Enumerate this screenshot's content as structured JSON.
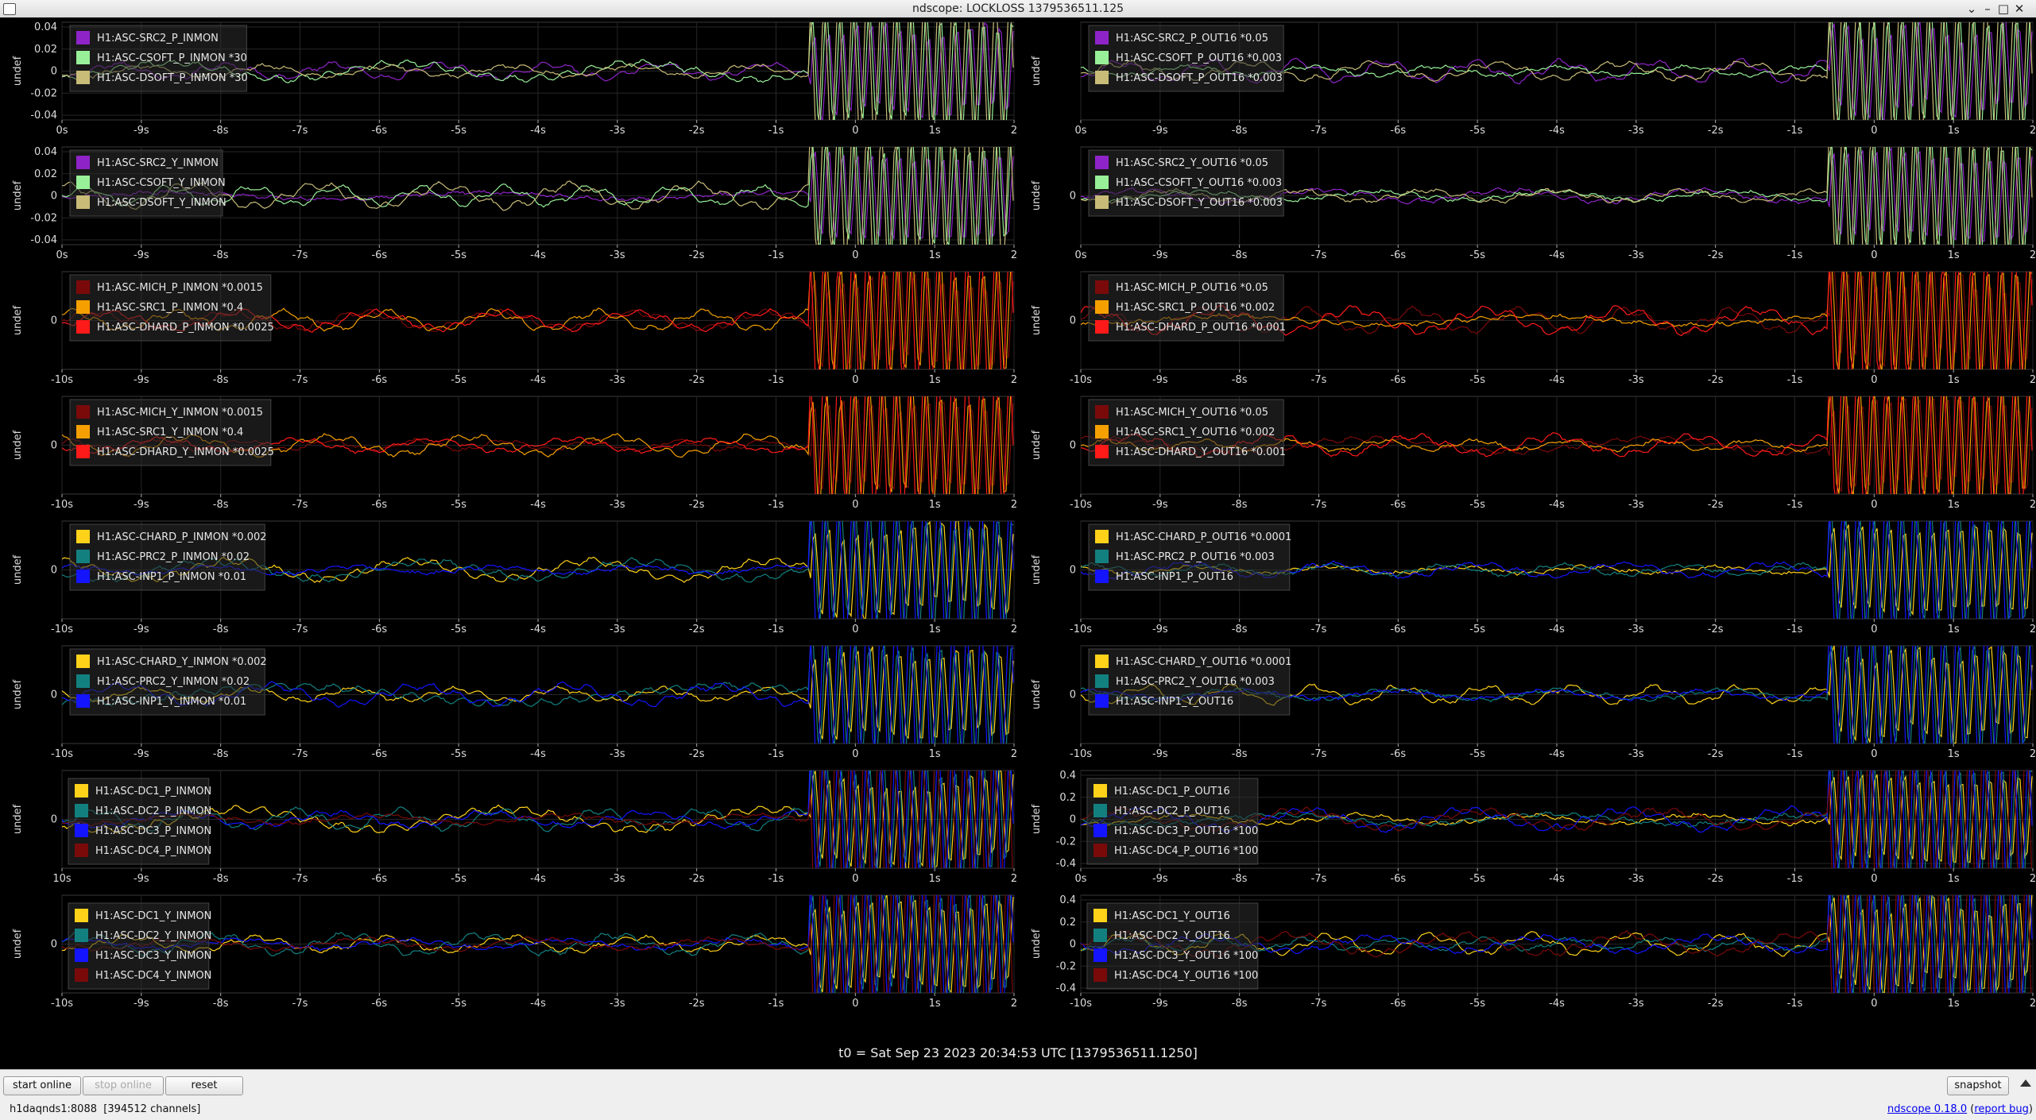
{
  "window": {
    "title": "ndscope: LOCKLOSS 1379536511.125",
    "min_icon": "minimize-icon",
    "max_icon": "maximize-icon",
    "close_icon": "close-icon"
  },
  "ylabel": "undef",
  "timebase": "t0 = Sat Sep 23 2023 20:34:53 UTC [1379536511.1250]",
  "controls": {
    "start_online": "start online",
    "stop_online": "stop online",
    "reset": "reset",
    "snapshot": "snapshot"
  },
  "status": {
    "server": "h1daqnds1:8088",
    "channels": "[394512 channels]",
    "version": "ndscope 0.18.0",
    "report_bug": "report bug"
  },
  "colors": {
    "purple": "#8e24c8",
    "lightgreen": "#98f098",
    "khaki": "#c8bc78",
    "darkred": "#7a0a0a",
    "orange": "#f5a000",
    "red": "#ff1a1a",
    "gold": "#ffd21a",
    "teal": "#138080",
    "blue": "#1414ff",
    "background": "#000000",
    "grid": "#262626"
  },
  "plots": [
    {
      "id": "SRC2_P_INMON",
      "col": 0,
      "row": 0,
      "xticks": [
        "0s",
        "-9s",
        "-8s",
        "-7s",
        "-6s",
        "-5s",
        "-4s",
        "-3s",
        "-2s",
        "-1s",
        "0",
        "1s",
        "2"
      ],
      "yticks": [
        "0.04",
        "0.02",
        "0",
        "-0.02",
        "-0.04"
      ],
      "legend": [
        {
          "label": "H1:ASC-SRC2_P_INMON",
          "color": "#8e24c8"
        },
        {
          "label": "H1:ASC-CSOFT_P_INMON *30",
          "color": "#98f098"
        },
        {
          "label": "H1:ASC-DSOFT_P_INMON *30",
          "color": "#c8bc78"
        }
      ]
    },
    {
      "id": "SRC2_P_OUT16",
      "col": 1,
      "row": 0,
      "xticks": [
        "0s",
        "-9s",
        "-8s",
        "-7s",
        "-6s",
        "-5s",
        "-4s",
        "-3s",
        "-2s",
        "-1s",
        "0",
        "1s",
        "2"
      ],
      "yticks": [],
      "legend": [
        {
          "label": "H1:ASC-SRC2_P_OUT16 *0.05",
          "color": "#8e24c8"
        },
        {
          "label": "H1:ASC-CSOFT_P_OUT16 *0.003",
          "color": "#98f098"
        },
        {
          "label": "H1:ASC-DSOFT_P_OUT16 *0.003",
          "color": "#c8bc78"
        }
      ]
    },
    {
      "id": "SRC2_Y_INMON",
      "col": 0,
      "row": 1,
      "xticks": [
        "0s",
        "-9s",
        "-8s",
        "-7s",
        "-6s",
        "-5s",
        "-4s",
        "-3s",
        "-2s",
        "-1s",
        "0",
        "1s",
        "2"
      ],
      "yticks": [
        "0.04",
        "0.02",
        "0",
        "-0.02",
        "-0.04"
      ],
      "legend": [
        {
          "label": "H1:ASC-SRC2_Y_INMON",
          "color": "#8e24c8"
        },
        {
          "label": "H1:ASC-CSOFT_Y_INMON",
          "color": "#98f098"
        },
        {
          "label": "H1:ASC-DSOFT_Y_INMON",
          "color": "#c8bc78"
        }
      ]
    },
    {
      "id": "SRC2_Y_OUT16",
      "col": 1,
      "row": 1,
      "xticks": [
        "0s",
        "-9s",
        "-8s",
        "-7s",
        "-6s",
        "-5s",
        "-4s",
        "-3s",
        "-2s",
        "-1s",
        "0",
        "1s",
        "2"
      ],
      "yticks": [
        "0"
      ],
      "legend": [
        {
          "label": "H1:ASC-SRC2_Y_OUT16 *0.05",
          "color": "#8e24c8"
        },
        {
          "label": "H1:ASC-CSOFT_Y_OUT16 *0.003",
          "color": "#98f098"
        },
        {
          "label": "H1:ASC-DSOFT_Y_OUT16 *0.003",
          "color": "#c8bc78"
        }
      ]
    },
    {
      "id": "MICH_P_INMON",
      "col": 0,
      "row": 2,
      "xticks": [
        "-10s",
        "-9s",
        "-8s",
        "-7s",
        "-6s",
        "-5s",
        "-4s",
        "-3s",
        "-2s",
        "-1s",
        "0",
        "1s",
        "2"
      ],
      "yticks": [
        "0"
      ],
      "legend": [
        {
          "label": "H1:ASC-MICH_P_INMON *0.0015",
          "color": "#7a0a0a"
        },
        {
          "label": "H1:ASC-SRC1_P_INMON *0.4",
          "color": "#f5a000"
        },
        {
          "label": "H1:ASC-DHARD_P_INMON *0.0025",
          "color": "#ff1a1a"
        }
      ]
    },
    {
      "id": "MICH_P_OUT16",
      "col": 1,
      "row": 2,
      "xticks": [
        "-10s",
        "-9s",
        "-8s",
        "-7s",
        "-6s",
        "-5s",
        "-4s",
        "-3s",
        "-2s",
        "-1s",
        "0",
        "1s",
        "2"
      ],
      "yticks": [
        "0"
      ],
      "legend": [
        {
          "label": "H1:ASC-MICH_P_OUT16 *0.05",
          "color": "#7a0a0a"
        },
        {
          "label": "H1:ASC-SRC1_P_OUT16 *0.002",
          "color": "#f5a000"
        },
        {
          "label": "H1:ASC-DHARD_P_OUT16 *0.001",
          "color": "#ff1a1a"
        }
      ]
    },
    {
      "id": "MICH_Y_INMON",
      "col": 0,
      "row": 3,
      "xticks": [
        "-10s",
        "-9s",
        "-8s",
        "-7s",
        "-6s",
        "-5s",
        "-4s",
        "-3s",
        "-2s",
        "-1s",
        "0",
        "1s",
        "2"
      ],
      "yticks": [
        "0"
      ],
      "legend": [
        {
          "label": "H1:ASC-MICH_Y_INMON *0.0015",
          "color": "#7a0a0a"
        },
        {
          "label": "H1:ASC-SRC1_Y_INMON *0.4",
          "color": "#f5a000"
        },
        {
          "label": "H1:ASC-DHARD_Y_INMON *0.0025",
          "color": "#ff1a1a"
        }
      ]
    },
    {
      "id": "MICH_Y_OUT16",
      "col": 1,
      "row": 3,
      "xticks": [
        "-10s",
        "-9s",
        "-8s",
        "-7s",
        "-6s",
        "-5s",
        "-4s",
        "-3s",
        "-2s",
        "-1s",
        "0",
        "1s",
        "2"
      ],
      "yticks": [
        "0"
      ],
      "legend": [
        {
          "label": "H1:ASC-MICH_Y_OUT16 *0.05",
          "color": "#7a0a0a"
        },
        {
          "label": "H1:ASC-SRC1_Y_OUT16 *0.002",
          "color": "#f5a000"
        },
        {
          "label": "H1:ASC-DHARD_Y_OUT16 *0.001",
          "color": "#ff1a1a"
        }
      ]
    },
    {
      "id": "CHARD_P_INMON",
      "col": 0,
      "row": 4,
      "xticks": [
        "-10s",
        "-9s",
        "-8s",
        "-7s",
        "-6s",
        "-5s",
        "-4s",
        "-3s",
        "-2s",
        "-1s",
        "0",
        "1s",
        "2"
      ],
      "yticks": [
        "0"
      ],
      "legend": [
        {
          "label": "H1:ASC-CHARD_P_INMON *0.002",
          "color": "#ffd21a"
        },
        {
          "label": "H1:ASC-PRC2_P_INMON *0.02",
          "color": "#138080"
        },
        {
          "label": "H1:ASC-INP1_P_INMON *0.01",
          "color": "#1414ff"
        }
      ]
    },
    {
      "id": "CHARD_P_OUT16",
      "col": 1,
      "row": 4,
      "xticks": [
        "-10s",
        "-9s",
        "-8s",
        "-7s",
        "-6s",
        "-5s",
        "-4s",
        "-3s",
        "-2s",
        "-1s",
        "0",
        "1s",
        "2"
      ],
      "yticks": [
        "0"
      ],
      "legend": [
        {
          "label": "H1:ASC-CHARD_P_OUT16 *0.0001",
          "color": "#ffd21a"
        },
        {
          "label": "H1:ASC-PRC2_P_OUT16 *0.003",
          "color": "#138080"
        },
        {
          "label": "H1:ASC-INP1_P_OUT16",
          "color": "#1414ff"
        }
      ]
    },
    {
      "id": "CHARD_Y_INMON",
      "col": 0,
      "row": 5,
      "xticks": [
        "-10s",
        "-9s",
        "-8s",
        "-7s",
        "-6s",
        "-5s",
        "-4s",
        "-3s",
        "-2s",
        "-1s",
        "0",
        "1s",
        "2"
      ],
      "yticks": [
        "0"
      ],
      "legend": [
        {
          "label": "H1:ASC-CHARD_Y_INMON *0.002",
          "color": "#ffd21a"
        },
        {
          "label": "H1:ASC-PRC2_Y_INMON *0.02",
          "color": "#138080"
        },
        {
          "label": "H1:ASC-INP1_Y_INMON *0.01",
          "color": "#1414ff"
        }
      ]
    },
    {
      "id": "CHARD_Y_OUT16",
      "col": 1,
      "row": 5,
      "xticks": [
        "-10s",
        "-9s",
        "-8s",
        "-7s",
        "-6s",
        "-5s",
        "-4s",
        "-3s",
        "-2s",
        "-1s",
        "0",
        "1s",
        "2"
      ],
      "yticks": [
        "0"
      ],
      "legend": [
        {
          "label": "H1:ASC-CHARD_Y_OUT16 *0.0001",
          "color": "#ffd21a"
        },
        {
          "label": "H1:ASC-PRC2_Y_OUT16 *0.003",
          "color": "#138080"
        },
        {
          "label": "H1:ASC-INP1_Y_OUT16",
          "color": "#1414ff"
        }
      ]
    },
    {
      "id": "DC_P_INMON",
      "col": 0,
      "row": 6,
      "xticks": [
        "10s",
        "-9s",
        "-8s",
        "-7s",
        "-6s",
        "-5s",
        "-4s",
        "-3s",
        "-2s",
        "-1s",
        "0",
        "1s",
        "2"
      ],
      "yticks": [
        "0"
      ],
      "legend": [
        {
          "label": "H1:ASC-DC1_P_INMON",
          "color": "#ffd21a"
        },
        {
          "label": "H1:ASC-DC2_P_INMON",
          "color": "#138080"
        },
        {
          "label": "H1:ASC-DC3_P_INMON",
          "color": "#1414ff"
        },
        {
          "label": "H1:ASC-DC4_P_INMON",
          "color": "#7a0a0a"
        }
      ]
    },
    {
      "id": "DC_P_OUT16",
      "col": 1,
      "row": 6,
      "xticks": [
        "0s",
        "-9s",
        "-8s",
        "-7s",
        "-6s",
        "-5s",
        "-4s",
        "-3s",
        "-2s",
        "-1s",
        "0",
        "1s",
        "2"
      ],
      "yticks": [
        "0.4",
        "0.2",
        "0",
        "-0.2",
        "-0.4"
      ],
      "legend": [
        {
          "label": "H1:ASC-DC1_P_OUT16",
          "color": "#ffd21a"
        },
        {
          "label": "H1:ASC-DC2_P_OUT16",
          "color": "#138080"
        },
        {
          "label": "H1:ASC-DC3_P_OUT16 *100",
          "color": "#1414ff"
        },
        {
          "label": "H1:ASC-DC4_P_OUT16 *100",
          "color": "#7a0a0a"
        }
      ]
    },
    {
      "id": "DC_Y_INMON",
      "col": 0,
      "row": 7,
      "xticks": [
        "-10s",
        "-9s",
        "-8s",
        "-7s",
        "-6s",
        "-5s",
        "-4s",
        "-3s",
        "-2s",
        "-1s",
        "0",
        "1s",
        "2"
      ],
      "yticks": [
        "0"
      ],
      "legend": [
        {
          "label": "H1:ASC-DC1_Y_INMON",
          "color": "#ffd21a"
        },
        {
          "label": "H1:ASC-DC2_Y_INMON",
          "color": "#138080"
        },
        {
          "label": "H1:ASC-DC3_Y_INMON",
          "color": "#1414ff"
        },
        {
          "label": "H1:ASC-DC4_Y_INMON",
          "color": "#7a0a0a"
        }
      ]
    },
    {
      "id": "DC_Y_OUT16",
      "col": 1,
      "row": 7,
      "xticks": [
        "-10s",
        "-9s",
        "-8s",
        "-7s",
        "-6s",
        "-5s",
        "-4s",
        "-3s",
        "-2s",
        "-1s",
        "0",
        "1s",
        "2"
      ],
      "yticks": [
        "0.4",
        "0.2",
        "0",
        "-0.2",
        "-0.4"
      ],
      "legend": [
        {
          "label": "H1:ASC-DC1_Y_OUT16",
          "color": "#ffd21a"
        },
        {
          "label": "H1:ASC-DC2_Y_OUT16",
          "color": "#138080"
        },
        {
          "label": "H1:ASC-DC3_Y_OUT16 *100",
          "color": "#1414ff"
        },
        {
          "label": "H1:ASC-DC4_Y_OUT16 *100",
          "color": "#7a0a0a"
        }
      ]
    }
  ]
}
